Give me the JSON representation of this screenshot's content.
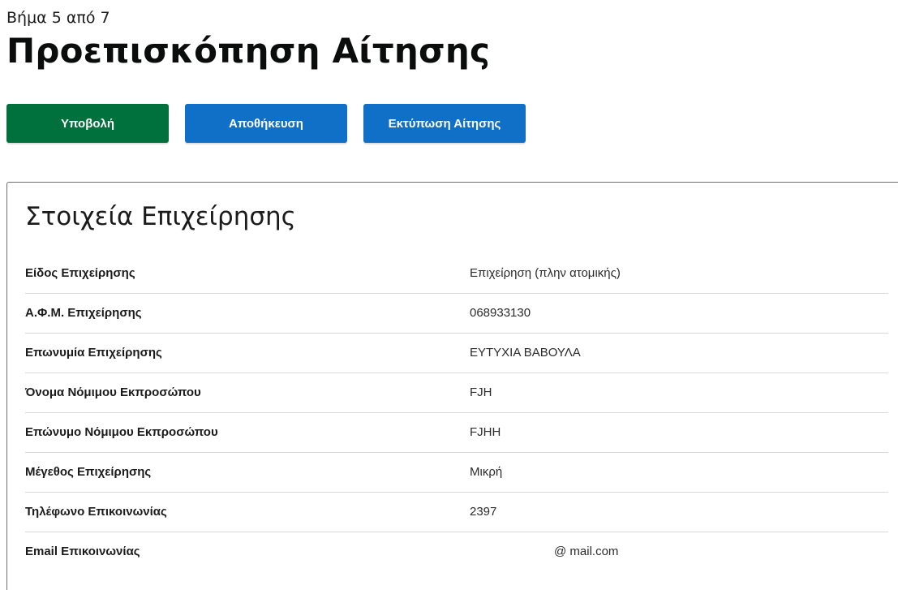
{
  "header": {
    "step": "Βήμα 5 από 7",
    "title": "Προεπισκόπηση Αίτησης"
  },
  "actions": {
    "submit_label": "Υποβολή",
    "save_label": "Αποθήκευση",
    "print_label": "Εκτύπωση Αίτησης"
  },
  "colors": {
    "submit": "#00703c",
    "primary": "#1070c8"
  },
  "business": {
    "title": "Στοιχεία Επιχείρησης",
    "rows": [
      {
        "label": "Είδος Επιχείρησης",
        "value": "Επιχείρηση (πλην ατομικής)"
      },
      {
        "label": "Α.Φ.Μ. Επιχείρησης",
        "value": "068933130"
      },
      {
        "label": "Επωνυμία Επιχείρησης",
        "value": "ΕΥΤΥΧΙΑ ΒΑΒΟΥΛΑ"
      },
      {
        "label": "Όνομα Νόμιμου Εκπροσώπου",
        "value": "FJH"
      },
      {
        "label": "Επώνυμο Νόμιμου Εκπροσώπου",
        "value": "FJHH"
      },
      {
        "label": "Μέγεθος Επιχείρησης",
        "value": "Μικρή"
      },
      {
        "label": "Τηλέφωνο Επικοινωνίας",
        "value": "2397"
      },
      {
        "label": "Email Επικοινωνίας",
        "value": "@ mail.com"
      }
    ]
  }
}
